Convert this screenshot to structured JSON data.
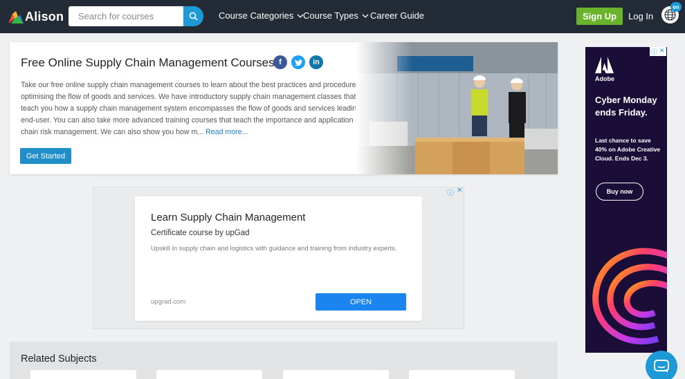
{
  "header": {
    "brand": "Alison",
    "search": {
      "placeholder": "Search for courses",
      "value": ""
    },
    "nav": [
      {
        "label": "Course Categories",
        "has_dropdown": true
      },
      {
        "label": "Course Types",
        "has_dropdown": true
      },
      {
        "label": "Career Guide",
        "has_dropdown": false
      }
    ],
    "signup_label": "Sign Up",
    "login_label": "Log In",
    "language": "en"
  },
  "hero": {
    "title": "Free Online Supply Chain Management Courses",
    "social": [
      "facebook-icon",
      "twitter-icon",
      "linkedin-icon"
    ],
    "description": "Take our free online supply chain management courses to learn about the best practices and procedures in optimising the flow of goods and services. We have introductory supply chain management classes that can teach you how a supply chain management system encompasses the flow of goods and services leading to the end-user. You can also take more advanced training courses that teach the importance and application of supply chain risk management. We can also show you how m...",
    "read_more": "Read more...",
    "cta": "Get Started"
  },
  "ad": {
    "title": "Learn Supply Chain Management",
    "subtitle": "Certificate course by upGad",
    "description": "Upskill in supply chain and logistics with guidance and training from industry experts.",
    "domain": "upgrad.com",
    "cta": "OPEN"
  },
  "related": {
    "title": "Related Subjects"
  },
  "side_ad": {
    "brand": "Adobe",
    "headline": "Cyber Monday ends Friday.",
    "body": "Last chance to save 40% on Adobe Creative Cloud. Ends Dec 3.",
    "cta": "Buy now"
  },
  "colors": {
    "topbar": "#232b36",
    "accent_blue": "#1d9ad6",
    "signup_green": "#6ab42d",
    "ad_blue": "#1a84f1",
    "side_ad_bg": "#1a0e39"
  }
}
